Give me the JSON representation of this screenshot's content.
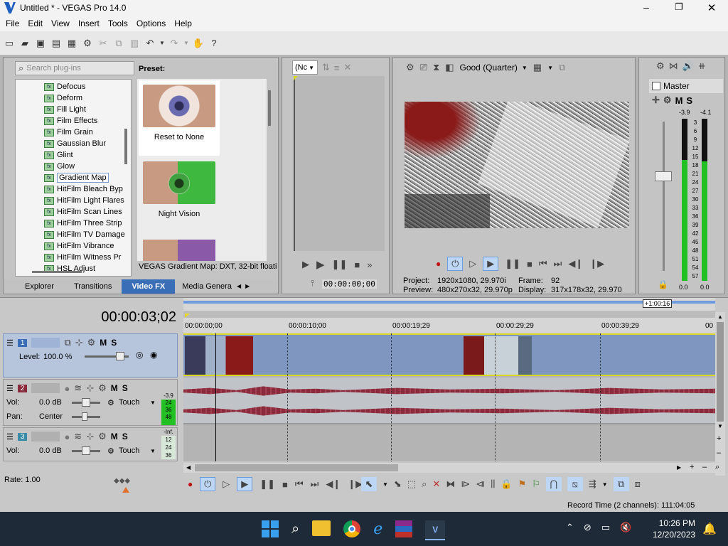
{
  "window": {
    "title": "Untitled * - VEGAS Pro 14.0"
  },
  "menu": [
    "File",
    "Edit",
    "View",
    "Insert",
    "Tools",
    "Options",
    "Help"
  ],
  "plugins": {
    "search_placeholder": "Search plug-ins",
    "items": [
      "Defocus",
      "Deform",
      "Fill Light",
      "Film Effects",
      "Film Grain",
      "Gaussian Blur",
      "Glint",
      "Glow",
      "Gradient Map",
      "HitFilm Bleach Byp",
      "HitFilm Light Flares",
      "HitFilm Scan Lines",
      "HitFilm Three Strip",
      "HitFilm TV Damage",
      "HitFilm Vibrance",
      "HitFilm Witness Pr",
      "HSL Adjust"
    ],
    "selected": "Gradient Map",
    "preset_label": "Preset:",
    "presets": [
      "Reset to None",
      "Night Vision"
    ],
    "status": "VEGAS Gradient Map: DXT, 32-bit floatin",
    "tabs": [
      "Explorer",
      "Transitions",
      "Video FX",
      "Media Genera"
    ],
    "active_tab": "Video FX"
  },
  "trimmer": {
    "dropdown": "(Nc",
    "timecode": "00:00:00;00"
  },
  "preview": {
    "quality": "Good (Quarter)",
    "project_label": "Project:",
    "project_value": "1920x1080, 29.970i",
    "preview_label": "Preview:",
    "preview_value": "480x270x32, 29.970p",
    "frame_label": "Frame:",
    "frame_value": "92",
    "display_label": "Display:",
    "display_value": "317x178x32, 29.970"
  },
  "master": {
    "title": "Master",
    "m": "M",
    "s": "S",
    "peak_left": "-3.9",
    "peak_right": "-4.1",
    "scale": [
      "3",
      "6",
      "9",
      "12",
      "15",
      "18",
      "21",
      "24",
      "27",
      "30",
      "33",
      "36",
      "39",
      "42",
      "45",
      "48",
      "51",
      "54",
      "57"
    ],
    "bottom_left": "0.0",
    "bottom_right": "0.0"
  },
  "timeline": {
    "timecode": "00:00:03;02",
    "end_marker": "+1:00:16",
    "ruler": [
      "00:00:00;00",
      "00:00:10;00",
      "00:00:19;29",
      "00:00:29;29",
      "00:00:39;29",
      "00"
    ],
    "tracks": [
      {
        "num": "1",
        "type": "video",
        "level_label": "Level:",
        "level_value": "100.0 %",
        "m": "M",
        "s": "S"
      },
      {
        "num": "2",
        "type": "audio",
        "vol_label": "Vol:",
        "vol_value": "0.0 dB",
        "pan_label": "Pan:",
        "pan_value": "Center",
        "touch": "Touch",
        "m": "M",
        "s": "S",
        "meter": [
          "-3.9",
          "24",
          "36",
          "48"
        ]
      },
      {
        "num": "3",
        "type": "audio",
        "vol_label": "Vol:",
        "vol_value": "0.0 dB",
        "touch": "Touch",
        "m": "M",
        "s": "S",
        "meter": [
          "-Inf.",
          "12",
          "24",
          "36"
        ]
      }
    ],
    "rate": "Rate: 1.00",
    "record_time": "Record Time (2 channels): 111:04:05"
  },
  "taskbar": {
    "time": "10:26 PM",
    "date": "12/20/2023"
  },
  "colors": {
    "accent": "#3a6fb8",
    "meter_green": "#22c022",
    "waveform": "#8b2a3c",
    "video_track": "#7f97c0"
  }
}
